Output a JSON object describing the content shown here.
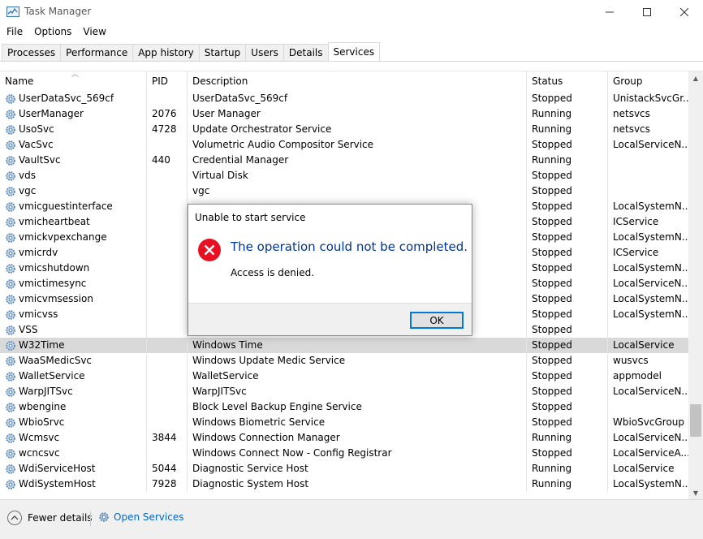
{
  "window": {
    "title": "Task Manager"
  },
  "menu": [
    "File",
    "Options",
    "View"
  ],
  "tabs": [
    "Processes",
    "Performance",
    "App history",
    "Startup",
    "Users",
    "Details",
    "Services"
  ],
  "active_tab": "Services",
  "columns": {
    "name": "Name",
    "pid": "PID",
    "description": "Description",
    "status": "Status",
    "group": "Group"
  },
  "rows": [
    {
      "name": "UserDataSvc_569cf",
      "pid": "",
      "desc": "UserDataSvc_569cf",
      "status": "Stopped",
      "group": "UnistackSvcGr..."
    },
    {
      "name": "UserManager",
      "pid": "2076",
      "desc": "User Manager",
      "status": "Running",
      "group": "netsvcs"
    },
    {
      "name": "UsoSvc",
      "pid": "4728",
      "desc": "Update Orchestrator Service",
      "status": "Running",
      "group": "netsvcs"
    },
    {
      "name": "VacSvc",
      "pid": "",
      "desc": "Volumetric Audio Compositor Service",
      "status": "Stopped",
      "group": "LocalServiceN..."
    },
    {
      "name": "VaultSvc",
      "pid": "440",
      "desc": "Credential Manager",
      "status": "Running",
      "group": ""
    },
    {
      "name": "vds",
      "pid": "",
      "desc": "Virtual Disk",
      "status": "Stopped",
      "group": ""
    },
    {
      "name": "vgc",
      "pid": "",
      "desc": "vgc",
      "status": "Stopped",
      "group": ""
    },
    {
      "name": "vmicguestinterface",
      "pid": "",
      "desc": "",
      "status": "Stopped",
      "group": "LocalSystemN..."
    },
    {
      "name": "vmicheartbeat",
      "pid": "",
      "desc": "",
      "status": "Stopped",
      "group": "ICService"
    },
    {
      "name": "vmickvpexchange",
      "pid": "",
      "desc": "",
      "status": "Stopped",
      "group": "LocalSystemN..."
    },
    {
      "name": "vmicrdv",
      "pid": "",
      "desc": "",
      "status": "Stopped",
      "group": "ICService"
    },
    {
      "name": "vmicshutdown",
      "pid": "",
      "desc": "",
      "status": "Stopped",
      "group": "LocalSystemN..."
    },
    {
      "name": "vmictimesync",
      "pid": "",
      "desc": "",
      "status": "Stopped",
      "group": "LocalServiceN..."
    },
    {
      "name": "vmicvmsession",
      "pid": "",
      "desc": "",
      "status": "Stopped",
      "group": "LocalSystemN..."
    },
    {
      "name": "vmicvss",
      "pid": "",
      "desc": "",
      "status": "Stopped",
      "group": "LocalSystemN..."
    },
    {
      "name": "VSS",
      "pid": "",
      "desc": "",
      "status": "Stopped",
      "group": ""
    },
    {
      "name": "W32Time",
      "pid": "",
      "desc": "Windows Time",
      "status": "Stopped",
      "group": "LocalService",
      "selected": true
    },
    {
      "name": "WaaSMedicSvc",
      "pid": "",
      "desc": "Windows Update Medic Service",
      "status": "Stopped",
      "group": "wusvcs"
    },
    {
      "name": "WalletService",
      "pid": "",
      "desc": "WalletService",
      "status": "Stopped",
      "group": "appmodel"
    },
    {
      "name": "WarpJITSvc",
      "pid": "",
      "desc": "WarpJITSvc",
      "status": "Stopped",
      "group": "LocalServiceN..."
    },
    {
      "name": "wbengine",
      "pid": "",
      "desc": "Block Level Backup Engine Service",
      "status": "Stopped",
      "group": ""
    },
    {
      "name": "WbioSrvc",
      "pid": "",
      "desc": "Windows Biometric Service",
      "status": "Stopped",
      "group": "WbioSvcGroup"
    },
    {
      "name": "Wcmsvc",
      "pid": "3844",
      "desc": "Windows Connection Manager",
      "status": "Running",
      "group": "LocalServiceN..."
    },
    {
      "name": "wcncsvc",
      "pid": "",
      "desc": "Windows Connect Now - Config Registrar",
      "status": "Stopped",
      "group": "LocalServiceA..."
    },
    {
      "name": "WdiServiceHost",
      "pid": "5044",
      "desc": "Diagnostic Service Host",
      "status": "Running",
      "group": "LocalService"
    },
    {
      "name": "WdiSystemHost",
      "pid": "7928",
      "desc": "Diagnostic System Host",
      "status": "Running",
      "group": "LocalSystemN..."
    }
  ],
  "footer": {
    "fewer_details": "Fewer details",
    "open_services": "Open Services"
  },
  "dialog": {
    "title": "Unable to start service",
    "main_instruction": "The operation could not be completed.",
    "detail": "Access is denied.",
    "ok_label": "OK"
  },
  "icons": {
    "service": "gear-icon",
    "error": "error-circle-icon"
  },
  "colors": {
    "link": "#0066cc",
    "dialog_heading": "#003399",
    "error_red": "#e81123",
    "selected_row": "#d9d9d9",
    "ok_border": "#0078d7"
  }
}
